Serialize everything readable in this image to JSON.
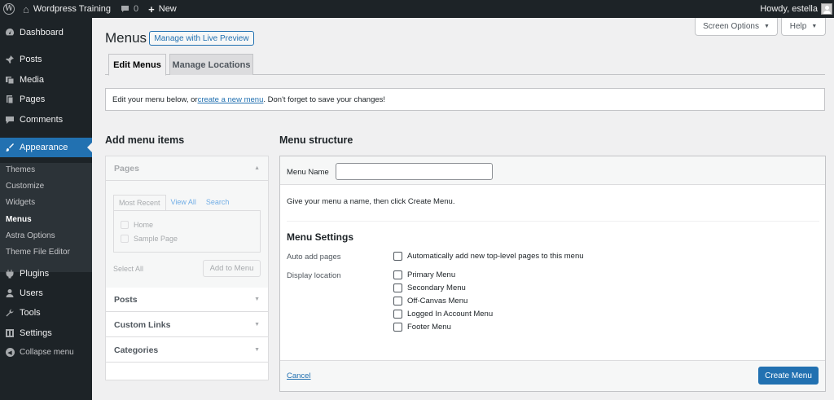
{
  "adminbar": {
    "site_name": "Wordpress Training",
    "comments_count": "0",
    "new_label": "New",
    "howdy": "Howdy, estella"
  },
  "sidebar": {
    "items": [
      {
        "label": "Dashboard",
        "icon": "dashboard-icon"
      },
      {
        "label": "Posts",
        "icon": "pushpin-icon"
      },
      {
        "label": "Media",
        "icon": "media-icon"
      },
      {
        "label": "Pages",
        "icon": "page-icon"
      },
      {
        "label": "Comments",
        "icon": "comment-icon"
      },
      {
        "label": "Appearance",
        "icon": "paintbrush-icon"
      }
    ],
    "submenu": [
      "Themes",
      "Customize",
      "Widgets",
      "Menus",
      "Astra Options",
      "Theme File Editor"
    ],
    "items2": [
      {
        "label": "Plugins",
        "icon": "plugin-icon"
      },
      {
        "label": "Users",
        "icon": "user-icon"
      },
      {
        "label": "Tools",
        "icon": "wrench-icon"
      },
      {
        "label": "Settings",
        "icon": "settings-icon"
      }
    ],
    "collapse": "Collapse menu"
  },
  "header": {
    "title": "Menus",
    "live_preview": "Manage with Live Preview",
    "screen_options": "Screen Options",
    "help": "Help"
  },
  "tabs": [
    "Edit Menus",
    "Manage Locations"
  ],
  "notice": {
    "before": "Edit your menu below, or ",
    "link": "create a new menu",
    "after": ". Don't forget to save your changes!"
  },
  "add_items": {
    "heading": "Add menu items",
    "pages_label": "Pages",
    "subtabs": [
      "Most Recent",
      "View All",
      "Search"
    ],
    "pages": [
      "Home",
      "Sample Page"
    ],
    "select_all": "Select All",
    "add_to_menu": "Add to Menu",
    "posts_label": "Posts",
    "custom_links_label": "Custom Links",
    "categories_label": "Categories"
  },
  "structure": {
    "heading": "Menu structure",
    "menu_name_label": "Menu Name",
    "menu_name_value": "",
    "hint": "Give your menu a name, then click Create Menu.",
    "settings_heading": "Menu Settings",
    "auto_add_label": "Auto add pages",
    "auto_add_option": "Automatically add new top-level pages to this menu",
    "display_location_label": "Display location",
    "locations": [
      "Primary Menu",
      "Secondary Menu",
      "Off-Canvas Menu",
      "Logged In Account Menu",
      "Footer Menu"
    ],
    "cancel": "Cancel",
    "create": "Create Menu"
  },
  "colors": {
    "accent": "#2271b1",
    "admin_bar": "#1d2327",
    "submenu_bg": "#2c3338"
  }
}
